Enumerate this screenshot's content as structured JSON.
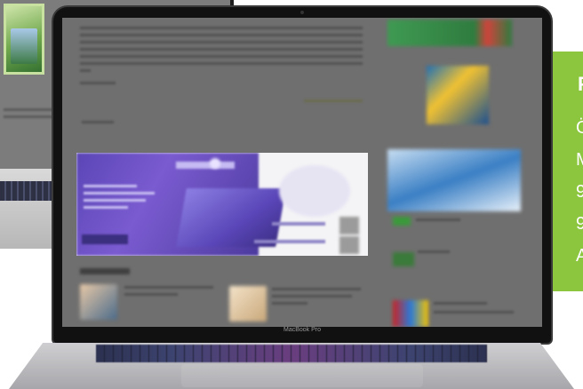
{
  "laptop": {
    "model_label": "MacBook Pro"
  },
  "green_card": {
    "heading": "P",
    "lines": [
      "Ö",
      "M",
      "9",
      "9",
      "A"
    ]
  },
  "colors": {
    "accent_green": "#8cc63f",
    "banner_purple": "#5b46b6"
  }
}
